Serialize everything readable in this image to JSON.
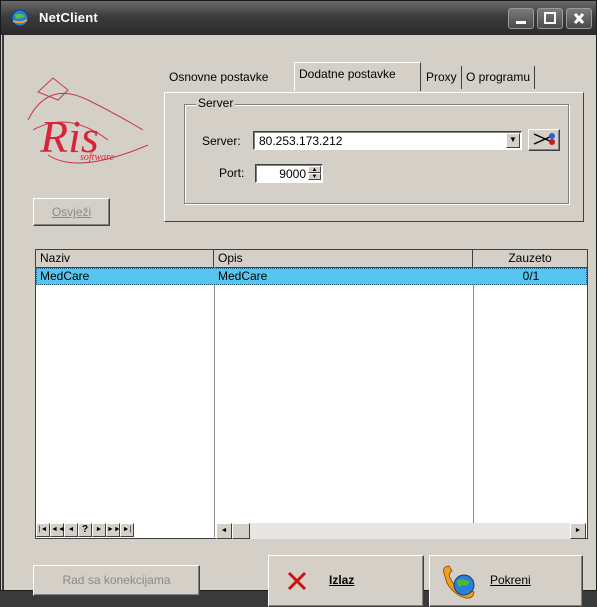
{
  "window": {
    "title": "NetClient"
  },
  "logo": {
    "text": "Ris",
    "sub": "software"
  },
  "buttons": {
    "refresh": "Osvježi",
    "connections": "Rad sa konekcijama",
    "exit": "Izlaz",
    "start": "Pokreni"
  },
  "tabs": [
    {
      "label": "Osnovne postavke"
    },
    {
      "label": "Dodatne postavke",
      "active": true
    },
    {
      "label": "Proxy"
    },
    {
      "label": "O programu"
    }
  ],
  "server_group": {
    "title": "Server",
    "server_label": "Server:",
    "server_value": "80.253.173.212",
    "port_label": "Port:",
    "port_value": "9000"
  },
  "grid": {
    "columns": [
      "Naziv",
      "Opis",
      "Zauzeto"
    ],
    "rows": [
      {
        "naziv": "MedCare",
        "opis": "MedCare",
        "zauzeto": "0/1"
      }
    ]
  },
  "navigator": {
    "buttons": [
      "|◄",
      "◄◄",
      "◄",
      "?",
      "►",
      "►►",
      "►|"
    ]
  },
  "colors": {
    "selection": "#56c6ee",
    "exit_x": "#d01010"
  }
}
